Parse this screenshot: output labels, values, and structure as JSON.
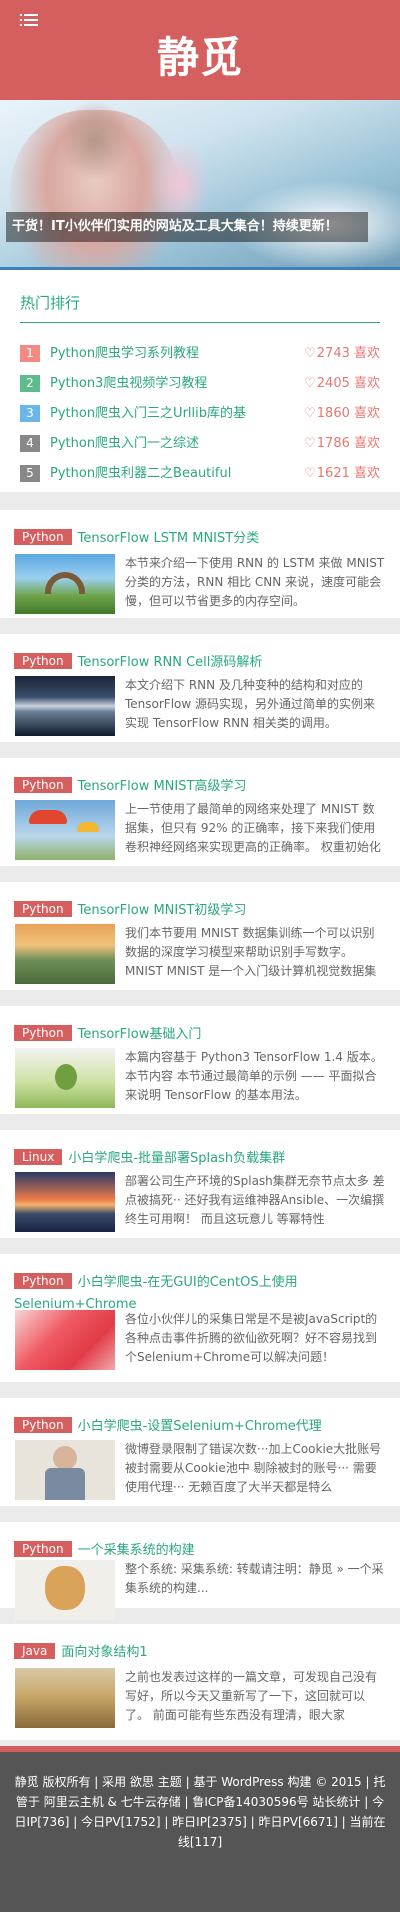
{
  "header": {
    "logo": "静觅",
    "menu_icon": "list-icon"
  },
  "banner": {
    "caption": "干货！IT小伙伴们实用的网站及工具大集合！持续更新！"
  },
  "hot": {
    "title": "热门排行",
    "items": [
      {
        "rank": "1",
        "name": "Python爬虫学习系列教程",
        "likes": "2743 喜欢",
        "color": "#f08a82"
      },
      {
        "rank": "2",
        "name": "Python3爬虫视频学习教程",
        "likes": "2405 喜欢",
        "color": "#5bbd8c"
      },
      {
        "rank": "3",
        "name": "Python爬虫入门三之Urllib库的基",
        "likes": "1860 喜欢",
        "color": "#6bb6e6"
      },
      {
        "rank": "4",
        "name": "Python爬虫入门一之综述",
        "likes": "1786 喜欢",
        "color": "#888888"
      },
      {
        "rank": "5",
        "name": "Python爬虫利器二之Beautiful",
        "likes": "1621 喜欢",
        "color": "#888888"
      }
    ]
  },
  "articles": [
    {
      "tag": "Python",
      "title": "TensorFlow LSTM MNIST分类",
      "excerpt": "本节来介绍一下使用 RNN 的 LSTM 来做 MNIST 分类的方法，RNN 相比 CNN 来说，速度可能会慢，但可以节省更多的内存空间。"
    },
    {
      "tag": "Python",
      "title": "TensorFlow RNN Cell源码解析",
      "excerpt": " 本文介绍下 RNN 及几种变种的结构和对应的 TensorFlow 源码实现，另外通过简单的实例来实现 TensorFlow RNN 相关类的调用。"
    },
    {
      "tag": "Python",
      "title": "TensorFlow MNIST高级学习",
      "excerpt": "上一节使用了最简单的网络来处理了 MNIST 数据集，但只有 92% 的正确率，接下来我们使用卷积神经网络来实现更高的正确率。 权重初始化"
    },
    {
      "tag": "Python",
      "title": "TensorFlow MNIST初级学习",
      "excerpt": "我们本节要用 MNIST 数据集训练一个可以识别数据的深度学习模型来帮助识别手写数字。 MNIST MNIST 是一个入门级计算机视觉数据集"
    },
    {
      "tag": "Python",
      "title": "TensorFlow基础入门",
      "excerpt": "本篇内容基于 Python3 TensorFlow 1.4 版本。 本节内容 本节通过最简单的示例 —— 平面拟合来说明 TensorFlow 的基本用法。"
    },
    {
      "tag": "Linux",
      "title": "小白学爬虫-批量部署Splash负载集群",
      "excerpt": "部署公司生产环境的Splash集群无奈节点太多 差点被搞死·· 还好我有运维神器Ansible、一次编撰终生可用啊！ 而且这玩意儿 等幂特性"
    },
    {
      "tag": "Python",
      "title": "小白学爬虫-在无GUI的CentOS上使用Selenium+Chrome",
      "excerpt": "各位小伙伴儿的采集日常是不是被JavaScript的各种点击事件折腾的欲仙欲死啊？好不容易找到个Selenium+Chrome可以解决问题！"
    },
    {
      "tag": "Python",
      "title": "小白学爬虫-设置Selenium+Chrome代理",
      "excerpt": " 微博登录限制了错误次数···加上Cookie大批账号被封需要从Cookie池中 剔除被封的账号··· 需要使用代理··· 无赖百度了大半天都是特么"
    },
    {
      "tag": "Python",
      "title": "一个采集系统的构建",
      "excerpt": "整个系统: 采集系统: 转载请注明：静觅 » 一个采集系统的构建..."
    },
    {
      "tag": "Java",
      "title": "面向对象结构1",
      "excerpt": "之前也发表过这样的一篇文章，可发现自己没有写好，所以今天又重新写了一下，这回就可以了。 前面可能有些东西没有理清，眼大家"
    }
  ],
  "footer": {
    "text": "静觅 版权所有 | 采用 欲思 主题 | 基于 WordPress 构建 © 2015 | 托管于 阿里云主机 & 七牛云存储 | 鲁ICP备14030596号 站长统计 | 今日IP[736] | 今日PV[1752] | 昨日IP[2375] | 昨日PV[6671] | 当前在线[117]"
  }
}
